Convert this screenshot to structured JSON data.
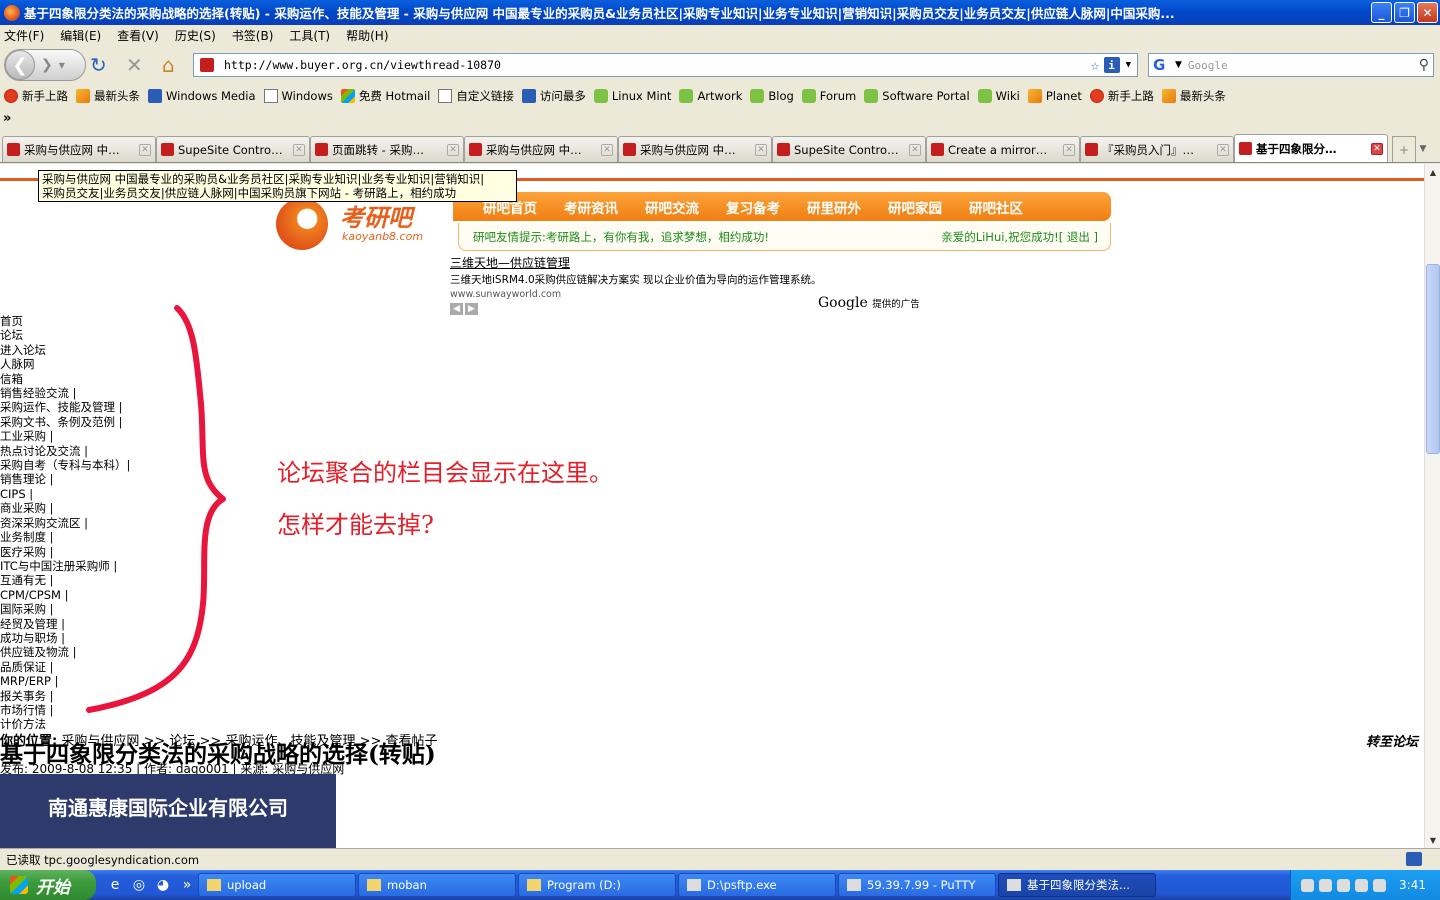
{
  "window": {
    "title": "基于四象限分类法的采购战略的选择(转贴) - 采购运作、技能及管理 - 采购与供应网 中国最专业的采购员&业务员社区|采购专业知识|业务专业知识|营销知识|采购员交友|业务员交友|供应链人脉网|中国采购..."
  },
  "menu": [
    "文件(F)",
    "编辑(E)",
    "查看(V)",
    "历史(S)",
    "书签(B)",
    "工具(T)",
    "帮助(H)"
  ],
  "nav": {
    "url": "http://www.buyer.org.cn/viewthread-10870",
    "search_placeholder": "Google"
  },
  "bookmarks": [
    {
      "label": "新手上路",
      "icon": "red"
    },
    {
      "label": "最新头条",
      "icon": "rss"
    },
    {
      "label": "Windows Media",
      "icon": "blue"
    },
    {
      "label": "Windows",
      "icon": "page"
    },
    {
      "label": "免费 Hotmail",
      "icon": "msn"
    },
    {
      "label": "自定义链接",
      "icon": "page"
    },
    {
      "label": "访问最多",
      "icon": "blue"
    },
    {
      "label": "Linux Mint",
      "icon": "mint"
    },
    {
      "label": "Artwork",
      "icon": "mint"
    },
    {
      "label": "Blog",
      "icon": "mint"
    },
    {
      "label": "Forum",
      "icon": "mint"
    },
    {
      "label": "Software Portal",
      "icon": "mint"
    },
    {
      "label": "Wiki",
      "icon": "mint"
    },
    {
      "label": "Planet",
      "icon": "rss"
    },
    {
      "label": "新手上路",
      "icon": "red"
    },
    {
      "label": "最新头条",
      "icon": "rss"
    }
  ],
  "chevron": "»",
  "tabs": [
    {
      "label": "采购与供应网 中…",
      "active": false
    },
    {
      "label": "SupeSite Contro…",
      "active": false
    },
    {
      "label": "页面跳转 - 采购…",
      "active": false
    },
    {
      "label": "采购与供应网 中…",
      "active": false
    },
    {
      "label": "采购与供应网 中…",
      "active": false
    },
    {
      "label": "SupeSite Contro…",
      "active": false
    },
    {
      "label": "Create a mirror…",
      "active": false
    },
    {
      "label": "『采购员入门』…",
      "active": false
    },
    {
      "label": "基于四象限分…",
      "active": true
    }
  ],
  "page": {
    "tooltip_line1": "采购与供应网 中国最专业的采购员&业务员社区|采购专业知识|业务专业知识|营销知识|",
    "tooltip_line2": "采购员交友|业务员交友|供应链人脉网|中国采购员旗下网站 - 考研路上，相约成功",
    "logo_cn": "考研吧",
    "logo_en": "kaoyanb8.com",
    "site_nav": [
      "研吧首页",
      "考研资讯",
      "研吧交流",
      "复习备考",
      "研里研外",
      "研吧家园",
      "研吧社区"
    ],
    "notice": "研吧友情提示:考研路上，有你有我，追求梦想，相约成功!",
    "user_greeting": "亲爱的LiHui,祝您成功![ 退出 ]",
    "ad": {
      "title": "三维天地—供应链管理",
      "desc": "三维天地iSRM4.0采购供应链解决方案实 现以企业价值为导向的运作管理系统。",
      "url": "www.sunwayworld.com",
      "google": "Google",
      "google_note": "提供的广告"
    },
    "side_links": [
      "首页",
      "论坛",
      "进入论坛",
      "人脉网",
      "信箱",
      "销售经验交流 |",
      "采购运作、技能及管理 |",
      "采购文书、条例及范例 |",
      "工业采购 |",
      "热点讨论及交流 |",
      "采购自考（专科与本科）|",
      "销售理论 |",
      "CIPS |",
      "商业采购 |",
      "资深采购交流区 |",
      "业务制度 |",
      "医疗采购 |",
      "ITC与中国注册采购师 |",
      "互通有无 |",
      "CPM/CPSM |",
      "国际采购 |",
      "经贸及管理 |",
      "成功与职场 |",
      "供应链及物流 |",
      "品质保证 |",
      "MRP/ERP |",
      "报关事务 |",
      "市场行情 |",
      "计价方法"
    ],
    "annotation_line1": "论坛聚合的栏目会显示在这里。",
    "annotation_line2": "怎样才能去掉?",
    "location_label": "你的位置:",
    "location_path": "采购与供应网 >> 论坛 >> 采购运作、技能及管理 >> 查看帖子",
    "transfer_link": "转至论坛",
    "post_title": "基于四象限分类法的采购战略的选择(转贴)",
    "post_meta": "发布: 2009-8-08 12:35 | 作者: daqo001 | 来源: 采购与供应网",
    "banner_text": "南通惠康国际企业有限公司"
  },
  "status": "已读取 tpc.googlesyndication.com",
  "taskbar": {
    "start_label": "开始",
    "tasks": [
      {
        "label": "upload",
        "active": false
      },
      {
        "label": "moban",
        "active": false
      },
      {
        "label": "Program (D:)",
        "active": false
      },
      {
        "label": "D:\\psftp.exe",
        "active": false
      },
      {
        "label": "59.39.7.99 - PuTTY",
        "active": false
      },
      {
        "label": "基于四象限分类法...",
        "active": true
      }
    ],
    "clock": "3:41"
  },
  "colors": {
    "accent_orange": "#f07f12",
    "annotation_red": "#e2202a",
    "xp_blue": "#245edb"
  }
}
